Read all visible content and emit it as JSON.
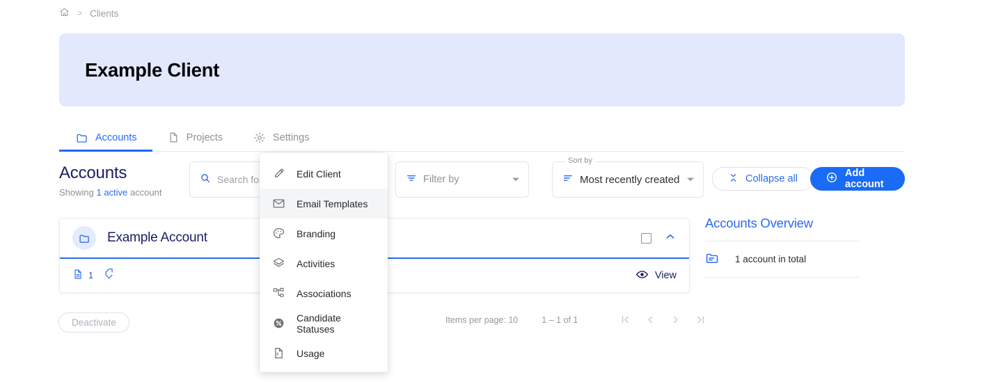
{
  "breadcrumb": {
    "home_icon": "home-icon",
    "separator": ">",
    "current": "Clients"
  },
  "banner": {
    "title": "Example Client",
    "background": "#e2e9fd"
  },
  "tabs": [
    {
      "label": "Accounts",
      "icon": "folder-icon",
      "active": true
    },
    {
      "label": "Projects",
      "icon": "document-icon",
      "active": false
    },
    {
      "label": "Settings",
      "icon": "gear-icon",
      "active": false
    }
  ],
  "toolbar": {
    "heading": "Accounts",
    "subtitle_prefix": "Showing ",
    "subtitle_highlight": "1 active",
    "subtitle_suffix": " account",
    "search_placeholder": "Search for n",
    "filter_label": "Filter by",
    "sort_float_label": "Sort by",
    "sort_value": "Most recently created",
    "collapse_all_label": "Collapse all",
    "add_account_label": "Add account"
  },
  "account_card": {
    "name": "Example Account",
    "project_count": "1",
    "project_icon": "document-icon",
    "tag_off_icon": "tag-off-icon",
    "checkbox_checked": false,
    "chevron": "chevron-up-icon",
    "view_label": "View",
    "view_icon": "eye-icon"
  },
  "overview": {
    "title": "Accounts Overview",
    "rows": [
      {
        "icon": "folder-open-icon",
        "text": "1 account in total"
      }
    ]
  },
  "footer": {
    "deactivate_label": "Deactivate",
    "items_per_page_label": "Items per page: 10",
    "range_label": "1 – 1 of 1",
    "first_page_icon": "first-page-icon",
    "prev_page_icon": "chevron-left-icon",
    "next_page_icon": "chevron-right-icon",
    "last_page_icon": "last-page-icon"
  },
  "context_menu": {
    "items": [
      {
        "label": "Edit Client",
        "icon": "pencil-icon",
        "highlighted": false
      },
      {
        "label": "Email Templates",
        "icon": "envelope-icon",
        "highlighted": true
      },
      {
        "label": "Branding",
        "icon": "palette-icon",
        "highlighted": false
      },
      {
        "label": "Activities",
        "icon": "layers-icon",
        "highlighted": false
      },
      {
        "label": "Associations",
        "icon": "sitemap-icon",
        "highlighted": false
      },
      {
        "label": "Candidate Statuses",
        "icon": "status-circle-icon",
        "highlighted": false
      },
      {
        "label": "Usage",
        "icon": "file-lines-icon",
        "highlighted": false
      }
    ]
  },
  "colors": {
    "accent_blue": "#1a6bf5",
    "link_blue": "#2a6bf2",
    "dark_navy": "#1b1d63",
    "banner_bg": "#e2e9fd",
    "muted_gray": "#9a9fa6"
  }
}
